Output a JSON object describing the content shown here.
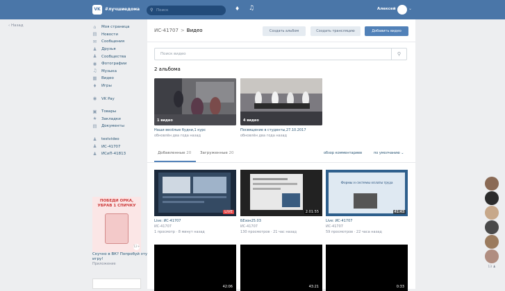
{
  "topbar": {
    "logo": "VK",
    "community": "#лучшиедома",
    "search_placeholder": "Поиск",
    "user_name": "Алексей"
  },
  "back_label": "Назад",
  "nav": [
    {
      "label": "Моя страница",
      "icon": "home-icon"
    },
    {
      "label": "Новости",
      "icon": "news-icon"
    },
    {
      "label": "Сообщения",
      "icon": "messages-icon"
    },
    {
      "label": "Друзья",
      "icon": "friends-icon"
    },
    {
      "label": "Сообщества",
      "icon": "groups-icon"
    },
    {
      "label": "Фотографии",
      "icon": "photo-icon"
    },
    {
      "label": "Музыка",
      "icon": "music-icon"
    },
    {
      "label": "Видео",
      "icon": "video-icon"
    },
    {
      "label": "Игры",
      "icon": "games-icon"
    },
    {
      "label": "VK Pay",
      "icon": "vkpay-icon"
    },
    {
      "label": "Товары",
      "icon": "market-icon"
    },
    {
      "label": "Закладки",
      "icon": "bookmark-icon"
    },
    {
      "label": "Документы",
      "icon": "documents-icon"
    },
    {
      "label": "testvideo",
      "icon": "group-icon"
    },
    {
      "label": "ИС-41707",
      "icon": "group-icon"
    },
    {
      "label": "ИСиП-41813",
      "icon": "group-icon"
    }
  ],
  "promo": {
    "title": "ПОБЕДИ ОРКА, УБРАВ 1 СПИЧКУ",
    "badge": "12+",
    "caption": "Скучно в ВК? Попробуй эту игру!",
    "sub": "Приложение"
  },
  "page": {
    "crumb": "ИС-41707",
    "separator": ">",
    "title": "Видео"
  },
  "buttons": {
    "create_album": "Создать альбом",
    "create_stream": "Создать трансляцию",
    "add_video": "Добавить видео"
  },
  "video_search_placeholder": "Поиск видео",
  "albums_count": "2 альбома",
  "albums": [
    {
      "badge": "1 видео",
      "title": "Наши весёлые будни,1 курс",
      "updated": "обновлён два года назад"
    },
    {
      "badge": "4 видео",
      "title": "Посвящение в студенты,27.10.2017",
      "updated": "обновлён два года назад"
    }
  ],
  "tabs": {
    "added_label": "Добавленные",
    "added_count": "20",
    "uploaded_label": "Загруженные",
    "uploaded_count": "20",
    "comments_link": "обзор комментариев",
    "sort_label": "по умолчанию"
  },
  "videos": [
    {
      "title": "Live: ИС-41707",
      "owner": "ИС-41707",
      "meta": "1 просмотр · 8 минут назад",
      "badge": "LIVE",
      "is_live": true
    },
    {
      "title": "БЕзон25.03",
      "owner": "ИС-41707",
      "meta": "130 просмотров · 21 час назад",
      "badge": "2:01:55",
      "is_live": false
    },
    {
      "title": "Live: ИС-41707",
      "owner": "ИС-41707",
      "meta": "59 просмотров · 22 часа назад",
      "badge": "41:43",
      "is_live": false,
      "slide_text": "Формы и системы оплаты труда"
    },
    {
      "badge": "42:06"
    },
    {
      "badge": "43:21"
    },
    {
      "badge": "0:33"
    }
  ],
  "dock_count": "13"
}
